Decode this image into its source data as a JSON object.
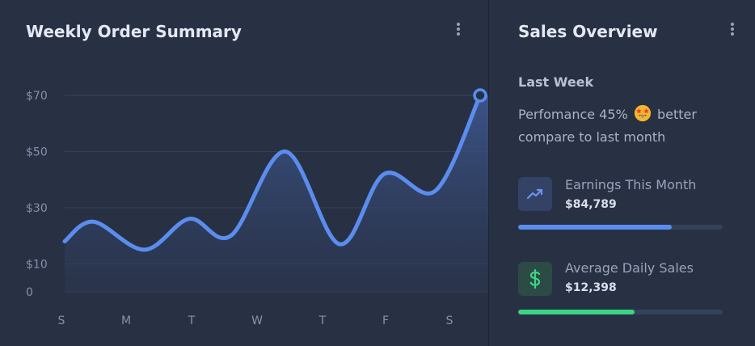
{
  "weekly_card": {
    "title": "Weekly Order Summary",
    "menu_icon": "kebab-vertical-icon"
  },
  "chart_data": {
    "type": "area",
    "categories": [
      "S",
      "M",
      "T",
      "W",
      "T",
      "F",
      "S"
    ],
    "x": [
      0,
      0.5,
      1,
      1.5,
      2,
      2.5,
      3,
      3.5,
      4,
      4.5,
      5,
      5.5,
      6,
      6.5
    ],
    "y": [
      18,
      25,
      15,
      26,
      20,
      50,
      17,
      42,
      36,
      70
    ],
    "yticks": [
      "0",
      "$10",
      "$30",
      "$50",
      "$70"
    ],
    "ylim": [
      0,
      78
    ],
    "grid": true,
    "colors": {
      "line": "#5b8def",
      "area": "#3a5288"
    }
  },
  "sales_card": {
    "title": "Sales Overview",
    "menu_icon": "kebab-vertical-icon",
    "subhead": "Last Week",
    "perf_before": "Perfomance 45%",
    "perf_emoji": "star-struck-emoji",
    "perf_after": "better compare to last month",
    "stats": [
      {
        "label": "Earnings This Month",
        "value": "$84,789",
        "icon": "trending-up-icon",
        "progress": 0.75,
        "color": "#5b8def"
      },
      {
        "label": "Average Daily Sales",
        "value": "$12,398",
        "icon": "dollar-icon",
        "progress": 0.57,
        "color": "#38d684"
      }
    ]
  }
}
